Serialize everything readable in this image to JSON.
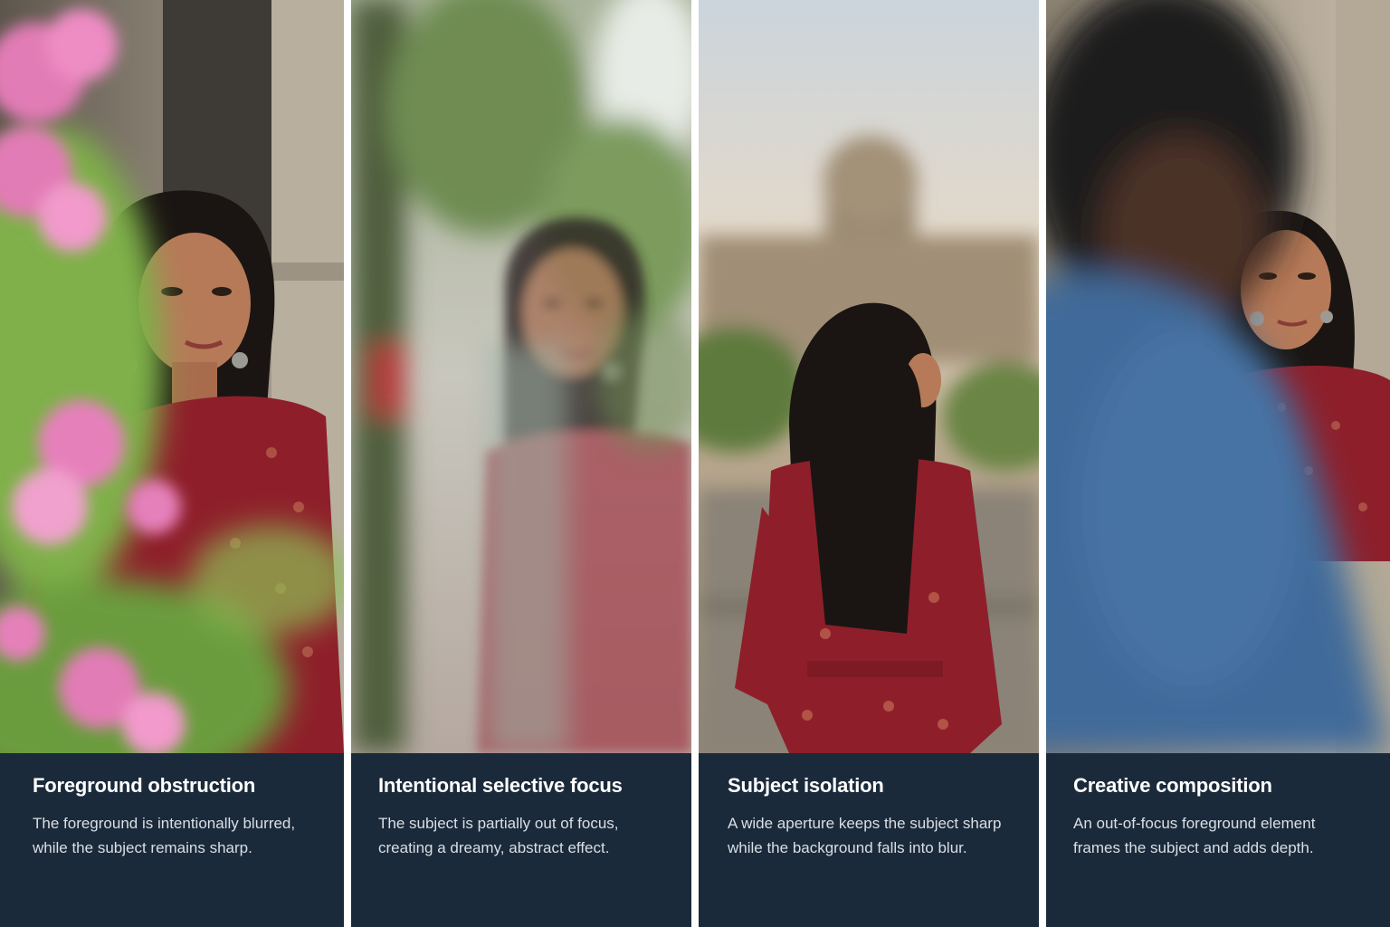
{
  "panels": [
    {
      "title": "Foreground obstruction",
      "desc_line1": "The foreground is intentionally blurred,",
      "desc_line2": "while the subject remains sharp."
    },
    {
      "title": "Intentional selective focus",
      "desc_line1": "The subject is partially out of focus,",
      "desc_line2": "creating a dreamy, abstract effect."
    },
    {
      "title": "Subject isolation",
      "desc_line1": "A wide aperture keeps the subject sharp",
      "desc_line2": "while the background falls into blur."
    },
    {
      "title": "Creative composition",
      "desc_line1": "An out-of-focus foreground element",
      "desc_line2": "frames the subject and adds depth."
    }
  ],
  "colors": {
    "caption_bg": "#1b2a3a",
    "title_text": "#ffffff",
    "desc_text": "#d9dfe6",
    "dress_red": "#8e1f2a",
    "flower_pink": "#e27bb6",
    "shirt_blue": "#3f6a9a"
  }
}
